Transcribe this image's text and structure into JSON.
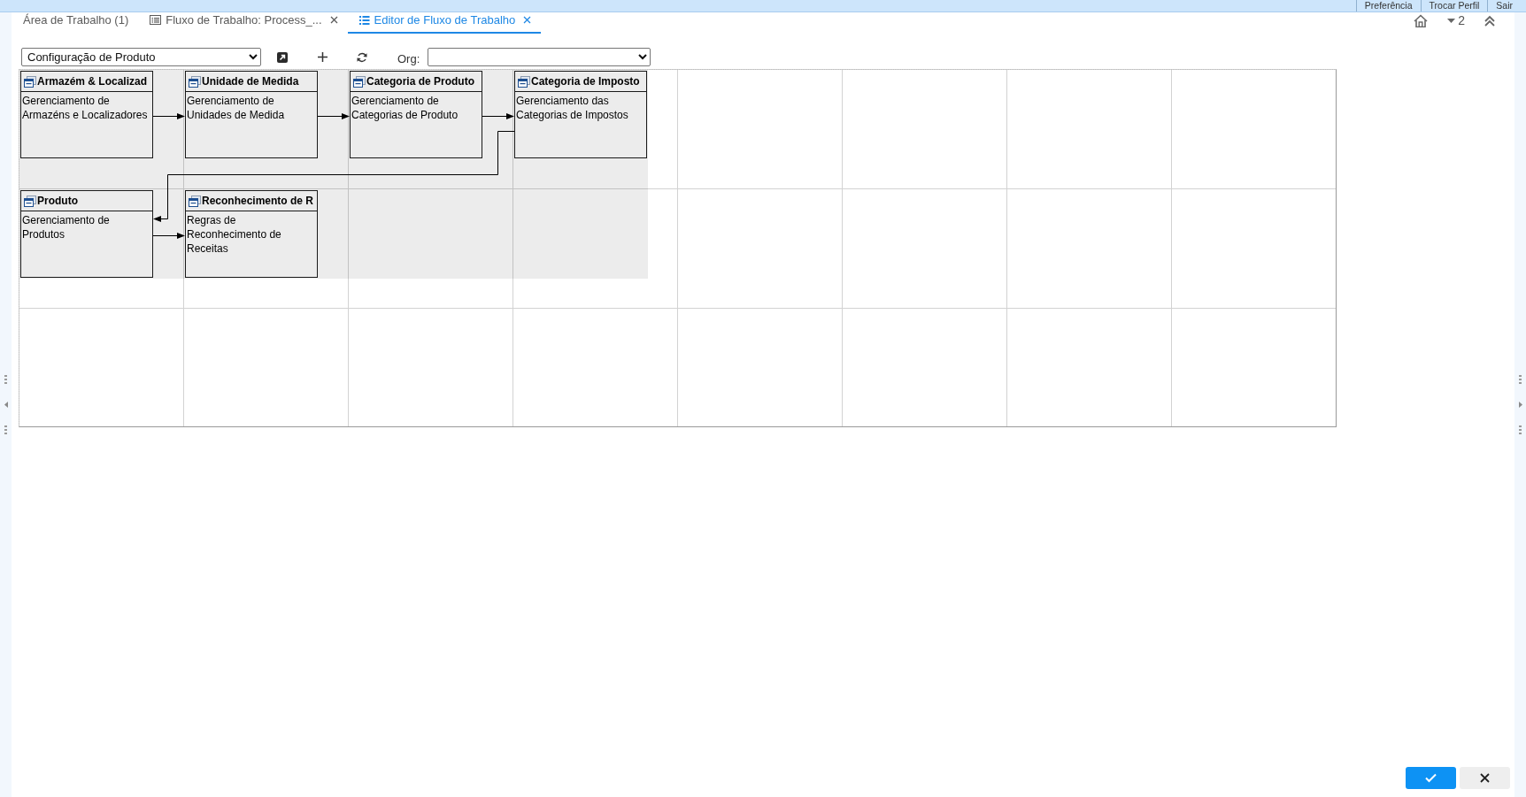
{
  "top_bar": {
    "links": [
      "Preferência",
      "Trocar Perfil",
      "Sair"
    ]
  },
  "tabs": [
    {
      "label": "Área de Trabalho (1)",
      "kind": "workspace",
      "selected": false,
      "closable": false
    },
    {
      "label": "Fluxo de Trabalho: Process_...",
      "kind": "window",
      "selected": false,
      "closable": true
    },
    {
      "label": "Editor de Fluxo de Trabalho",
      "kind": "editor",
      "selected": true,
      "closable": true
    }
  ],
  "window_menu": {
    "count": "2"
  },
  "toolbar": {
    "workflow": "Configuração de Produto",
    "org_label": "Org:"
  },
  "workflow": {
    "nodes": [
      {
        "title": "Armazém & Localizad",
        "description": "Gerenciamento de Armazéns e Localizadores"
      },
      {
        "title": "Unidade de Medida",
        "description": "Gerenciamento de Unidades de Medida"
      },
      {
        "title": "Categoria de Produto",
        "description": "Gerenciamento de Categorias de Produto"
      },
      {
        "title": "Categoria de Imposto",
        "description": "Gerenciamento das Categorias de Impostos"
      },
      {
        "title": "Produto",
        "description": "Gerenciamento de Produtos"
      },
      {
        "title": "Reconhecimento de R",
        "description": "Regras de Reconhecimento de Receitas"
      }
    ]
  }
}
